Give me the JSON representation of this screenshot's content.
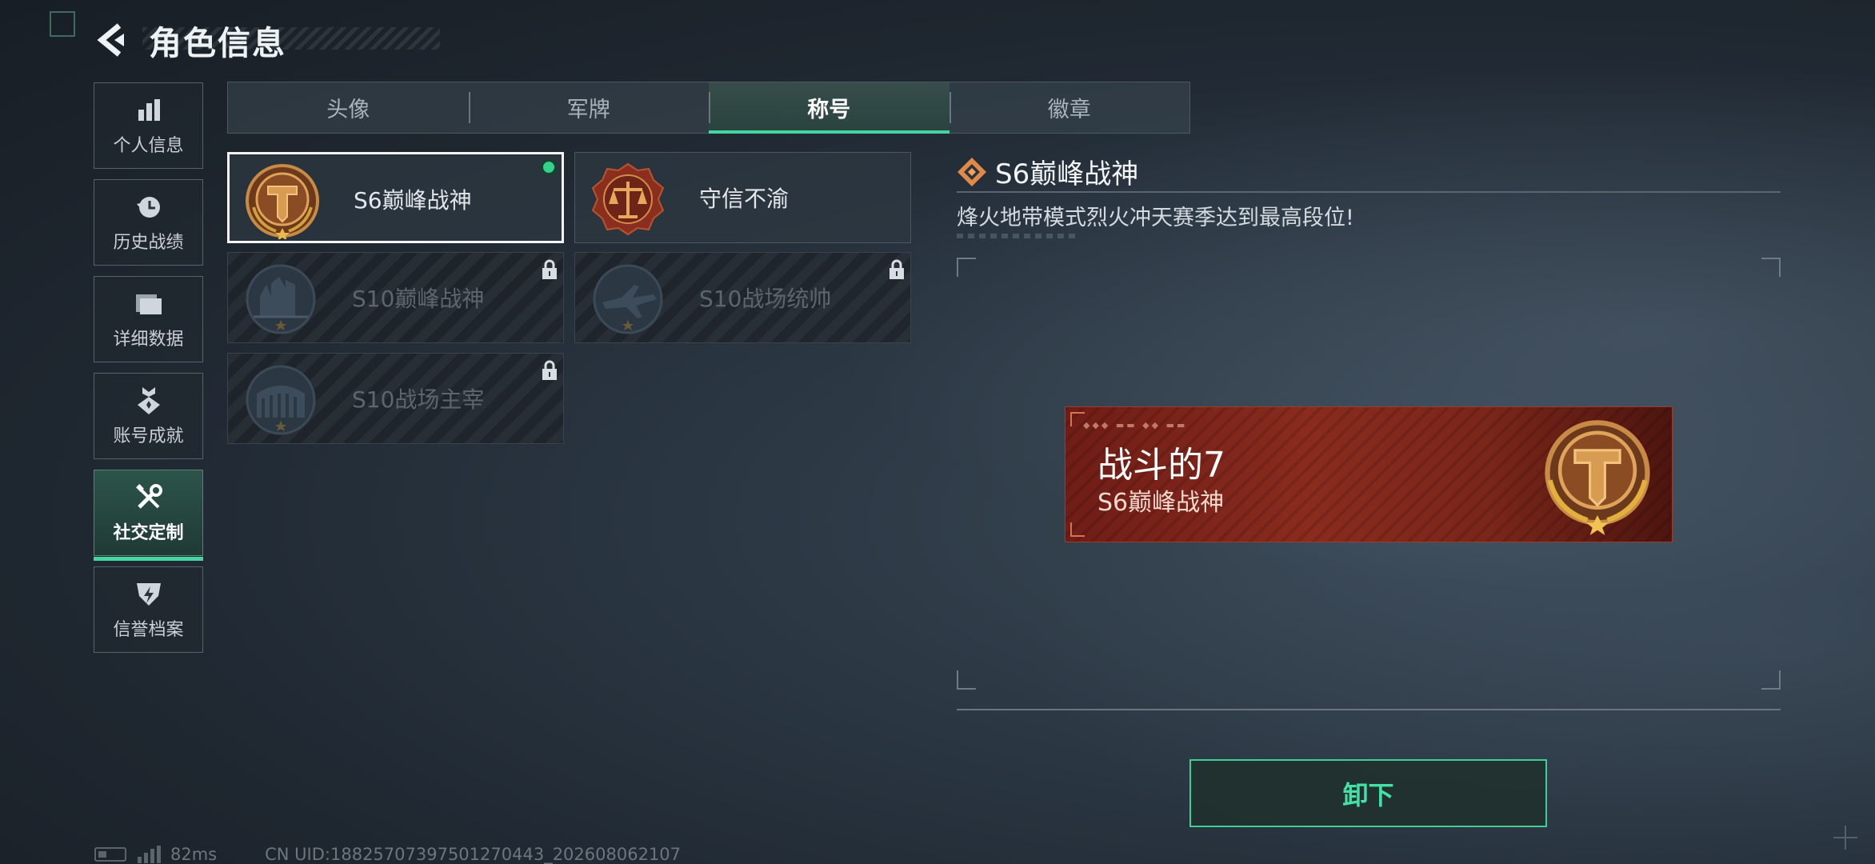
{
  "header": {
    "title": "角色信息"
  },
  "sidebar": {
    "items": [
      {
        "label": "个人信息",
        "icon": "bar-chart-icon"
      },
      {
        "label": "历史战绩",
        "icon": "history-clock-icon"
      },
      {
        "label": "详细数据",
        "icon": "folder-icon"
      },
      {
        "label": "账号成就",
        "icon": "achievement-medal-icon"
      },
      {
        "label": "社交定制",
        "icon": "tools-icon",
        "active": true
      },
      {
        "label": "信誉档案",
        "icon": "credit-shield-icon"
      }
    ]
  },
  "tabs": [
    {
      "label": "头像"
    },
    {
      "label": "军牌"
    },
    {
      "label": "称号",
      "active": true
    },
    {
      "label": "徽章"
    }
  ],
  "titles": [
    {
      "name": "S6巅峰战神",
      "locked": false,
      "equipped": true
    },
    {
      "name": "守信不渝",
      "locked": false
    },
    {
      "name": "S10巅峰战神",
      "locked": true
    },
    {
      "name": "S10战场统帅",
      "locked": true
    },
    {
      "name": "S10战场主宰",
      "locked": true
    }
  ],
  "detail": {
    "title": "S6巅峰战神",
    "description": "烽火地带模式烈火冲天赛季达到最高段位!",
    "banner": {
      "player_name": "战斗的7",
      "title": "S6巅峰战神"
    },
    "unequip_label": "卸下"
  },
  "status": {
    "ping": "82ms",
    "uid": "CN UID:18825707397501270443_202608062107"
  },
  "colors": {
    "accent": "#45d6a0",
    "banner_red": "#8a2b1e",
    "bronze": "#b87a3a"
  }
}
